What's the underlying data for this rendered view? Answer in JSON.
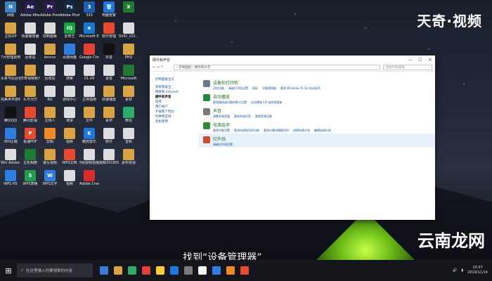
{
  "desktop": {
    "icons": [
      {
        "label": "网络",
        "color": "#3b82c4",
        "glyph": "N"
      },
      {
        "label": "Adobe After Effects CC",
        "color": "#2a1a55",
        "glyph": "Ae"
      },
      {
        "label": "Adobe Premiere P...",
        "color": "#2a1a55",
        "glyph": "Pr"
      },
      {
        "label": "Adobe Photosh...",
        "color": "#0e2a4a",
        "glyph": "Ps"
      },
      {
        "label": "333",
        "color": "#1a5fb4",
        "glyph": "3"
      },
      {
        "label": "电脑管家",
        "color": "#1c78e0",
        "glyph": "管"
      },
      {
        "label": "",
        "color": "#1e7b32",
        "glyph": "X"
      },
      {
        "label": "主机OP",
        "color": "#d9a441",
        "glyph": ""
      },
      {
        "label": "快速播放器",
        "color": "#ddd",
        "glyph": ""
      },
      {
        "label": "控制面板",
        "color": "#ddd",
        "glyph": ""
      },
      {
        "label": "爱奇艺",
        "color": "#15a33b",
        "glyph": "iQ"
      },
      {
        "label": "Microsoft Edge",
        "color": "#1478d4",
        "glyph": "e"
      },
      {
        "label": "软件管理",
        "color": "#e9492d",
        "glyph": ""
      },
      {
        "label": "SVID_201...",
        "color": "#ddd",
        "glyph": ""
      },
      {
        "label": "7月管理费用明细",
        "color": "#d9a441",
        "glyph": ""
      },
      {
        "label": "回收站",
        "color": "#ddd",
        "glyph": ""
      },
      {
        "label": "lenovo",
        "color": "#d9a441",
        "glyph": ""
      },
      {
        "label": "百度网盘",
        "color": "#2e7de1",
        "glyph": ""
      },
      {
        "label": "Google Chrome",
        "color": "#e44134",
        "glyph": ""
      },
      {
        "label": "抖音",
        "color": "#111",
        "glyph": ""
      },
      {
        "label": "PHD",
        "color": "#d9a441",
        "glyph": ""
      },
      {
        "label": "头条号后台视频",
        "color": "#d9a441",
        "glyph": ""
      },
      {
        "label": "天奇视频帐户",
        "color": "#d9a441",
        "glyph": ""
      },
      {
        "label": "回收站",
        "color": "#ddd",
        "glyph": ""
      },
      {
        "label": "搜索",
        "color": "#ddd",
        "glyph": ""
      },
      {
        "label": "01.09",
        "color": "#ddd",
        "glyph": ""
      },
      {
        "label": "录音",
        "color": "#ddd",
        "glyph": ""
      },
      {
        "label": "Microsoft",
        "color": "#1e7b32",
        "glyph": ""
      },
      {
        "label": "完美世界游戏",
        "color": "#d9a441",
        "glyph": ""
      },
      {
        "label": "头号大厅",
        "color": "#d9a441",
        "glyph": ""
      },
      {
        "label": "BG",
        "color": "#ddd",
        "glyph": ""
      },
      {
        "label": "游戏中心",
        "color": "#ddd",
        "glyph": ""
      },
      {
        "label": "主持指南",
        "color": "#ddd",
        "glyph": ""
      },
      {
        "label": "快速播放",
        "color": "#d9a441",
        "glyph": ""
      },
      {
        "label": "素材",
        "color": "#d9a441",
        "glyph": ""
      },
      {
        "label": "腾讯QQ",
        "color": "#111",
        "glyph": ""
      },
      {
        "label": "腾讯影视",
        "color": "#e9492d",
        "glyph": ""
      },
      {
        "label": "主持人",
        "color": "#d9a441",
        "glyph": ""
      },
      {
        "label": "演讲",
        "color": "#ddd",
        "glyph": ""
      },
      {
        "label": "文件",
        "color": "#d9a441",
        "glyph": ""
      },
      {
        "label": "素材",
        "color": "#d9a441",
        "glyph": ""
      },
      {
        "label": "微信",
        "color": "#2aae67",
        "glyph": ""
      },
      {
        "label": "360压缩",
        "color": "#2e7de1",
        "glyph": ""
      },
      {
        "label": "极速PDF",
        "color": "#e9492d",
        "glyph": "P"
      },
      {
        "label": "剪辑",
        "color": "#f08a24",
        "glyph": ""
      },
      {
        "label": "视频",
        "color": "#d9a441",
        "glyph": ""
      },
      {
        "label": "酷狗音乐",
        "color": "#1c78e0",
        "glyph": "K"
      },
      {
        "label": "软件",
        "color": "#ddd",
        "glyph": ""
      },
      {
        "label": "音频",
        "color": "#ddd",
        "glyph": ""
      },
      {
        "label": "Win Adobe cc 2018",
        "color": "#ddd",
        "glyph": ""
      },
      {
        "label": "主机相册",
        "color": "#1e7b32",
        "glyph": ""
      },
      {
        "label": "速写视频",
        "color": "#d9a441",
        "glyph": ""
      },
      {
        "label": "WPS文档",
        "color": "#e9492d",
        "glyph": ""
      },
      {
        "label": "5组视频拍摄2019",
        "color": "#ddd",
        "glyph": ""
      },
      {
        "label": "视频2019091...",
        "color": "#ddd",
        "glyph": ""
      },
      {
        "label": "素材资源",
        "color": "#d9a441",
        "glyph": ""
      },
      {
        "label": "WPS H5",
        "color": "#2e7de1",
        "glyph": ""
      },
      {
        "label": "WPS表格",
        "color": "#1e9e4e",
        "glyph": "S"
      },
      {
        "label": "WPS文字",
        "color": "#2e7de1",
        "glyph": "W"
      },
      {
        "label": "视频",
        "color": "#ddd",
        "glyph": ""
      },
      {
        "label": "Adobe Creati...",
        "color": "#d92b2b",
        "glyph": ""
      }
    ]
  },
  "watermark": {
    "top": "天奇·视频",
    "bottom": "云南龙网"
  },
  "subtitle": "找到“设备管理器”",
  "window": {
    "title": "硬件和声音",
    "minimize": "—",
    "maximize": "☐",
    "close": "✕",
    "nav_back": "← →  ↑",
    "path": "› 控制面板 › 硬件和声音",
    "search_placeholder": "搜索控制面板",
    "leftnav": {
      "home": "控制面板主页",
      "items": [
        "系统和安全",
        "网络和 Internet",
        "硬件和声音",
        "程序",
        "用户帐户",
        "外观和个性化",
        "时钟和区域",
        "轻松使用"
      ],
      "current": "硬件和声音"
    },
    "categories": [
      {
        "title": "设备和打印机",
        "icon_color": "#6b7a8c",
        "links": [
          "添加设备",
          "高级打印机设置",
          "鼠标",
          "设备管理器",
          "更改 Windows To Go 启动选项"
        ]
      },
      {
        "title": "自动播放",
        "icon_color": "#1e8c3a",
        "links": [
          "更改媒体或设备的默认设置",
          "自动播放 CD 或其他媒体"
        ]
      },
      {
        "title": "声音",
        "icon_color": "#7a7a7a",
        "links": [
          "调整系统音量",
          "更改系统声音",
          "管理音频设备"
        ]
      },
      {
        "title": "电源选项",
        "icon_color": "#2f8f2f",
        "links": [
          "更改节能设置",
          "更改电源按钮的功能",
          "更改计算机睡眠时间",
          "选择电源计划",
          "编辑电源计划"
        ]
      },
      {
        "title": "Realtek高清晰音频管理器",
        "icon_color": "#d34a2a",
        "links": []
      }
    ],
    "last_category_short": "红外线",
    "last_category_sublink": "高级红外线设置"
  },
  "taskbar": {
    "start_glyph": "⊞",
    "search_placeholder": "在这里输入你要搜索的内容",
    "apps": [
      "#3a7be0",
      "#d9a441",
      "#2aae67",
      "#e44134",
      "#ffcc33",
      "#1c78e0",
      "#7a7a7a",
      "#ffffff",
      "#2e7de1",
      "#f08a24",
      "#e9492d"
    ],
    "time": "15:07",
    "date": "2019/11/14"
  }
}
